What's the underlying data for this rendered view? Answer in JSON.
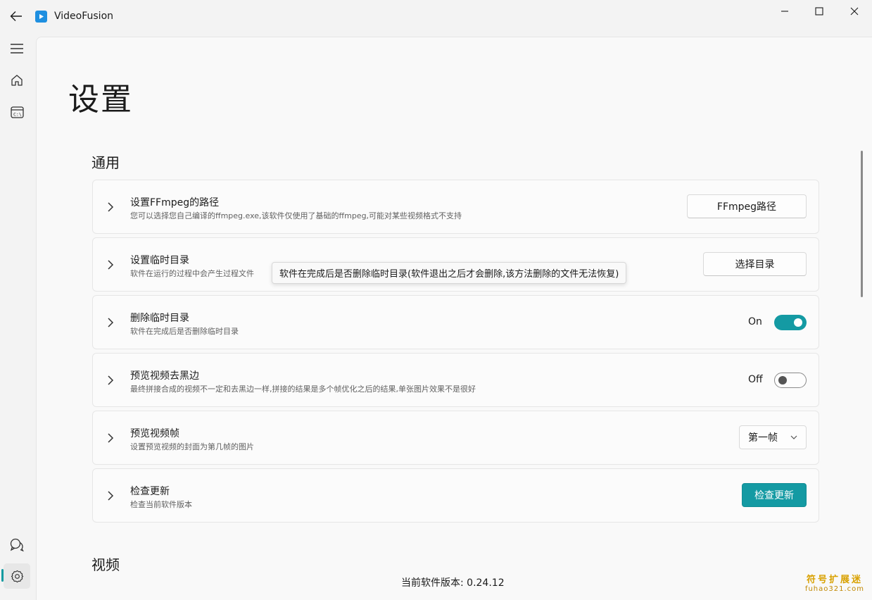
{
  "app": {
    "title": "VideoFusion"
  },
  "icons": {
    "back": "arrow-left-icon",
    "app": "play-icon",
    "minimize": "minimize-icon",
    "maximize": "maximize-icon",
    "close": "close-icon",
    "menu": "hamburger-icon",
    "home": "home-icon",
    "terminal": "terminal-icon",
    "feedback": "chat-icon",
    "settings": "gear-icon",
    "chevron": "chevron-right-icon",
    "dropdown": "chevron-down-icon"
  },
  "page": {
    "title": "设置"
  },
  "sections": {
    "general": "通用",
    "video": "视频"
  },
  "settings": [
    {
      "title": "设置FFmpeg的路径",
      "description": "您可以选择您自己编译的ffmpeg.exe,该软件仅使用了基础的ffmpeg,可能对某些视频格式不支持",
      "control": "FFmpeg路径"
    },
    {
      "title": "设置临时目录",
      "description": "软件在运行的过程中会产生过程文件",
      "control": "选择目录"
    },
    {
      "title": "删除临时目录",
      "description": "软件在完成后是否删除临时目录",
      "state": "On",
      "checked": true
    },
    {
      "title": "预览视频去黑边",
      "description": "最终拼接合成的视频不一定和去黑边一样,拼接的结果是多个帧优化之后的结果,单张图片效果不是很好",
      "state": "Off",
      "checked": false
    },
    {
      "title": "预览视频帧",
      "description": "设置预览视频的封面为第几帧的图片",
      "selected": "第一帧"
    },
    {
      "title": "检查更新",
      "description": "检查当前软件版本",
      "control": "检查更新"
    }
  ],
  "tooltip": "软件在完成后是否删除临时目录(软件退出之后才会删除,该方法删除的文件无法恢复)",
  "footer": {
    "version": "当前软件版本: 0.24.12"
  },
  "watermark": {
    "top": "符号扩展迷",
    "bottom": "fuhao321.com"
  },
  "colors": {
    "accent": "#149aa3",
    "background": "#f3f3f3",
    "content": "#f9f9f9"
  }
}
